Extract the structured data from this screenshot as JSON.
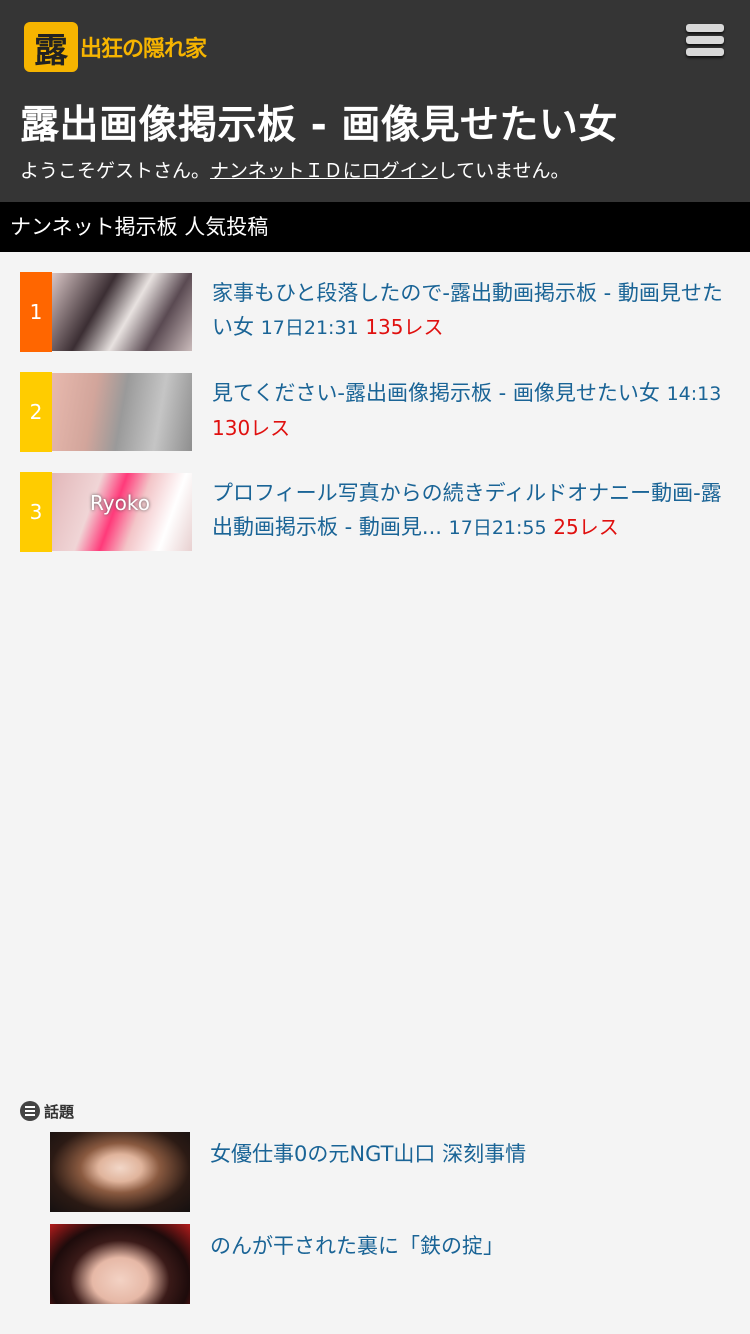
{
  "header": {
    "logo_mark": "露",
    "logo_text": "出狂の隠れ家",
    "title": "露出画像掲示板 - 画像見せたい女",
    "welcome_prefix": "ようこそゲストさん。",
    "login_link": "ナンネットＩＤにログイン",
    "welcome_suffix": "していません。"
  },
  "section": {
    "title": "ナンネット掲示板 人気投稿"
  },
  "ranking": [
    {
      "rank": "1",
      "color": "#ff6600",
      "title": "家事もひと段落したので-露出動画掲示板 - 動画見せたい女",
      "time": "17日21:31",
      "res": "135レス"
    },
    {
      "rank": "2",
      "color": "#ffcc00",
      "title": "見てください-露出画像掲示板 - 画像見せたい女",
      "time": "14:13",
      "res": "130レス"
    },
    {
      "rank": "3",
      "color": "#ffcc00",
      "title": "プロフィール写真からの続きディルドオナニー動画-露出動画掲示板 - 動画見...",
      "time": "17日21:55",
      "res": "25レス",
      "thumb_label": "Ryoko"
    }
  ],
  "topics": {
    "heading": "話題",
    "items": [
      {
        "title": "女優仕事0の元NGT山口 深刻事情"
      },
      {
        "title": "のんが干された裏に「鉄の掟」"
      }
    ]
  }
}
